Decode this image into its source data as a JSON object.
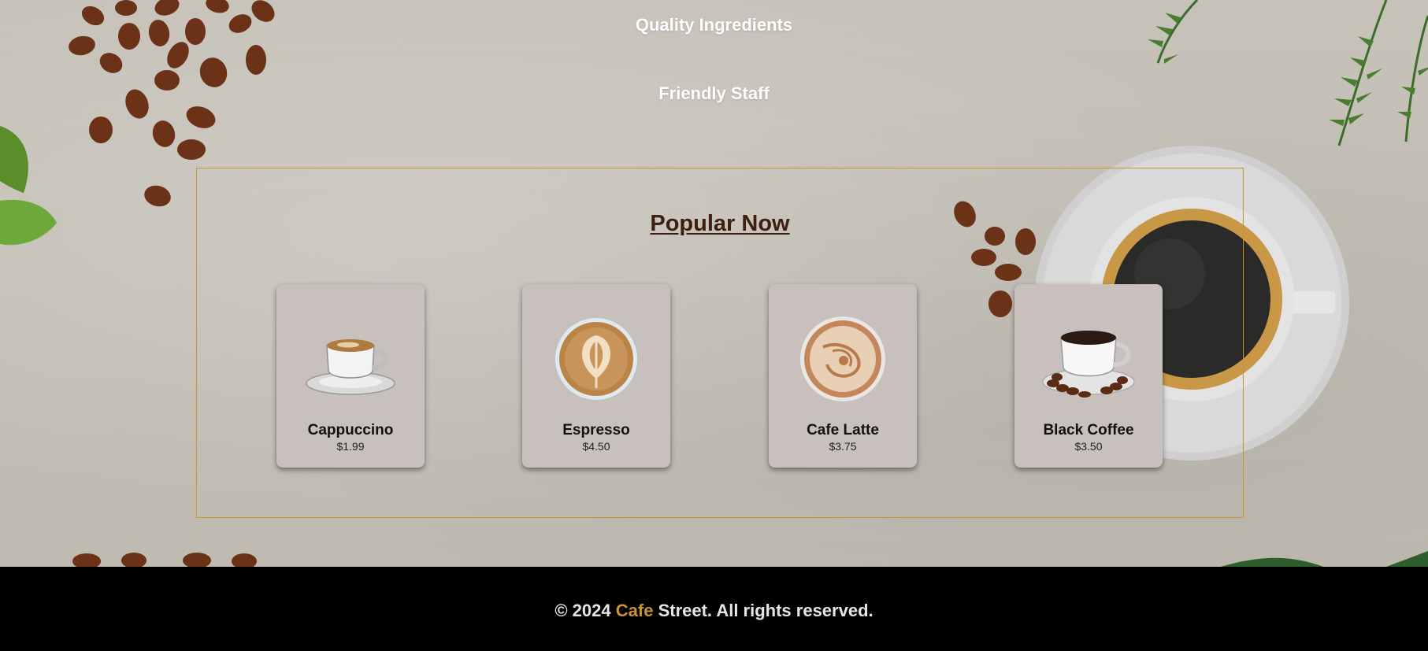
{
  "features": {
    "quality": "Quality Ingredients",
    "staff": "Friendly Staff"
  },
  "popular": {
    "title": "Popular Now",
    "items": [
      {
        "name": "Cappuccino",
        "price": "$1.99",
        "image": "cappuccino-cup-icon"
      },
      {
        "name": "Espresso",
        "price": "$4.50",
        "image": "latte-art-icon"
      },
      {
        "name": "Cafe Latte",
        "price": "$3.75",
        "image": "latte-foam-icon"
      },
      {
        "name": "Black Coffee",
        "price": "$3.50",
        "image": "black-coffee-cup-icon"
      }
    ]
  },
  "footer": {
    "copyright": "© 2024",
    "brand": "Cafe",
    "rest": "Street. All rights reserved."
  },
  "colors": {
    "accent": "#c89432",
    "title": "#3b1f10",
    "card": "#c7c0bd",
    "footer_bg": "#000000"
  }
}
